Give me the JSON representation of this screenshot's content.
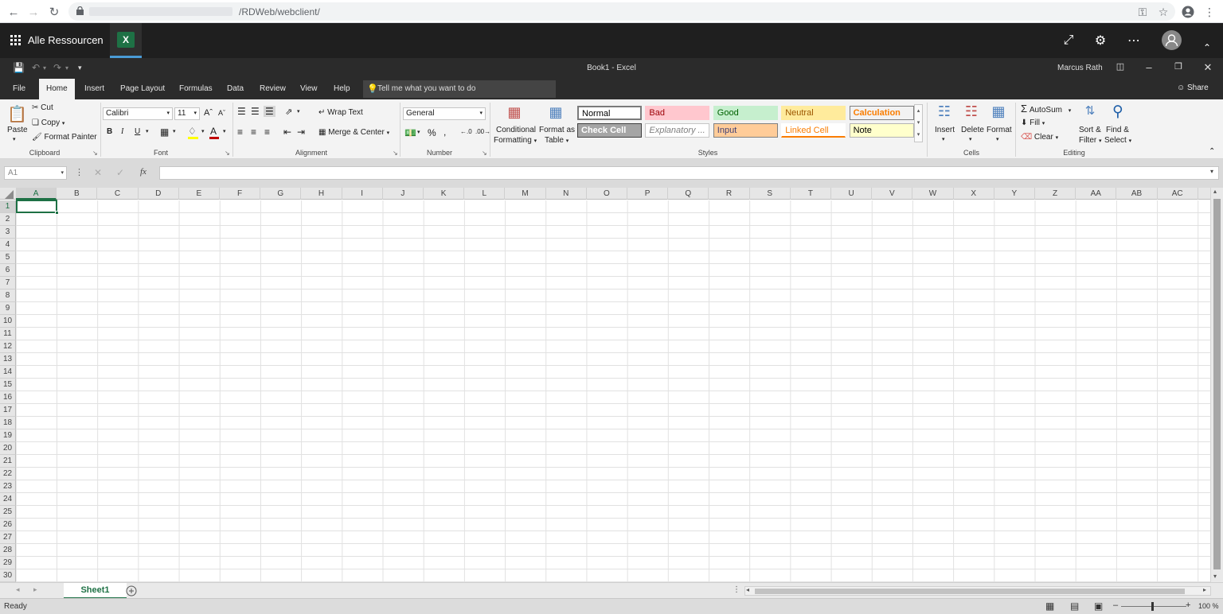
{
  "browser": {
    "url_path": "/RDWeb/webclient/"
  },
  "rdweb": {
    "title": "Alle Ressourcen",
    "app_icon_letter": "X"
  },
  "excel": {
    "document_title": "Book1  -  Excel",
    "user": "Marcus Rath",
    "share_label": "Share",
    "tabs": [
      "File",
      "Home",
      "Insert",
      "Page Layout",
      "Formulas",
      "Data",
      "Review",
      "View",
      "Help"
    ],
    "active_tab": "Home",
    "tell_me": "Tell me what you want to do",
    "ribbon": {
      "clipboard": {
        "label": "Clipboard",
        "paste": "Paste",
        "cut": "Cut",
        "copy": "Copy",
        "format_painter": "Format Painter"
      },
      "font": {
        "label": "Font",
        "name": "Calibri",
        "size": "11"
      },
      "alignment": {
        "label": "Alignment",
        "wrap_text": "Wrap Text",
        "merge_center": "Merge & Center"
      },
      "number": {
        "label": "Number",
        "format": "General"
      },
      "styles": {
        "label": "Styles",
        "conditional_formatting": [
          "Conditional",
          "Formatting"
        ],
        "format_as_table": [
          "Format as",
          "Table"
        ],
        "cells": [
          {
            "name": "Normal",
            "bg": "#ffffff",
            "color": "#000000",
            "border": "#7a7a7a",
            "bold": false,
            "italic": false
          },
          {
            "name": "Bad",
            "bg": "#ffc7ce",
            "color": "#9c0006",
            "border": "#ffc7ce",
            "bold": false,
            "italic": false
          },
          {
            "name": "Good",
            "bg": "#c6efce",
            "color": "#006100",
            "border": "#c6efce",
            "bold": false,
            "italic": false
          },
          {
            "name": "Neutral",
            "bg": "#ffeb9c",
            "color": "#9c5700",
            "border": "#ffeb9c",
            "bold": false,
            "italic": false
          },
          {
            "name": "Calculation",
            "bg": "#f2f2f2",
            "color": "#fa7d00",
            "border": "#7f7f7f",
            "bold": true,
            "italic": false
          },
          {
            "name": "Check Cell",
            "bg": "#a5a5a5",
            "color": "#ffffff",
            "border": "#3f3f3f",
            "bold": true,
            "italic": false
          },
          {
            "name": "Explanatory ...",
            "bg": "#ffffff",
            "color": "#7f7f7f",
            "border": "#c6c6c6",
            "bold": false,
            "italic": true
          },
          {
            "name": "Input",
            "bg": "#ffcc99",
            "color": "#3f3f76",
            "border": "#7f7f7f",
            "bold": false,
            "italic": false
          },
          {
            "name": "Linked Cell",
            "bg": "#ffffff",
            "color": "#fa7d00",
            "border": "#ffffff",
            "bold": false,
            "italic": false
          },
          {
            "name": "Note",
            "bg": "#ffffcc",
            "color": "#000000",
            "border": "#b2b2b2",
            "bold": false,
            "italic": false
          }
        ]
      },
      "cells": {
        "label": "Cells",
        "insert": "Insert",
        "delete": "Delete",
        "format": "Format"
      },
      "editing": {
        "label": "Editing",
        "autosum": "AutoSum",
        "fill": "Fill",
        "clear": "Clear",
        "sort_filter": [
          "Sort &",
          "Filter"
        ],
        "find_select": [
          "Find &",
          "Select"
        ]
      }
    },
    "name_box": "A1",
    "formula": "",
    "columns": [
      "A",
      "B",
      "C",
      "D",
      "E",
      "F",
      "G",
      "H",
      "I",
      "J",
      "K",
      "L",
      "M",
      "N",
      "O",
      "P",
      "Q",
      "R",
      "S",
      "T",
      "U",
      "V",
      "W",
      "X",
      "Y",
      "Z",
      "AA",
      "AB",
      "AC"
    ],
    "rows": [
      "1",
      "2",
      "3",
      "4",
      "5",
      "6",
      "7",
      "8",
      "9",
      "10",
      "11",
      "12",
      "13",
      "14",
      "15",
      "16",
      "17",
      "18",
      "19",
      "20",
      "21",
      "22",
      "23",
      "24",
      "25",
      "26",
      "27",
      "28",
      "29",
      "30"
    ],
    "selected_cell": {
      "column": "A",
      "row": "1"
    },
    "sheets": [
      "Sheet1"
    ],
    "status": "Ready",
    "zoom": "100 %"
  },
  "colors": {
    "excel_green": "#1e7145",
    "dark_bar": "#2b2b2b"
  }
}
